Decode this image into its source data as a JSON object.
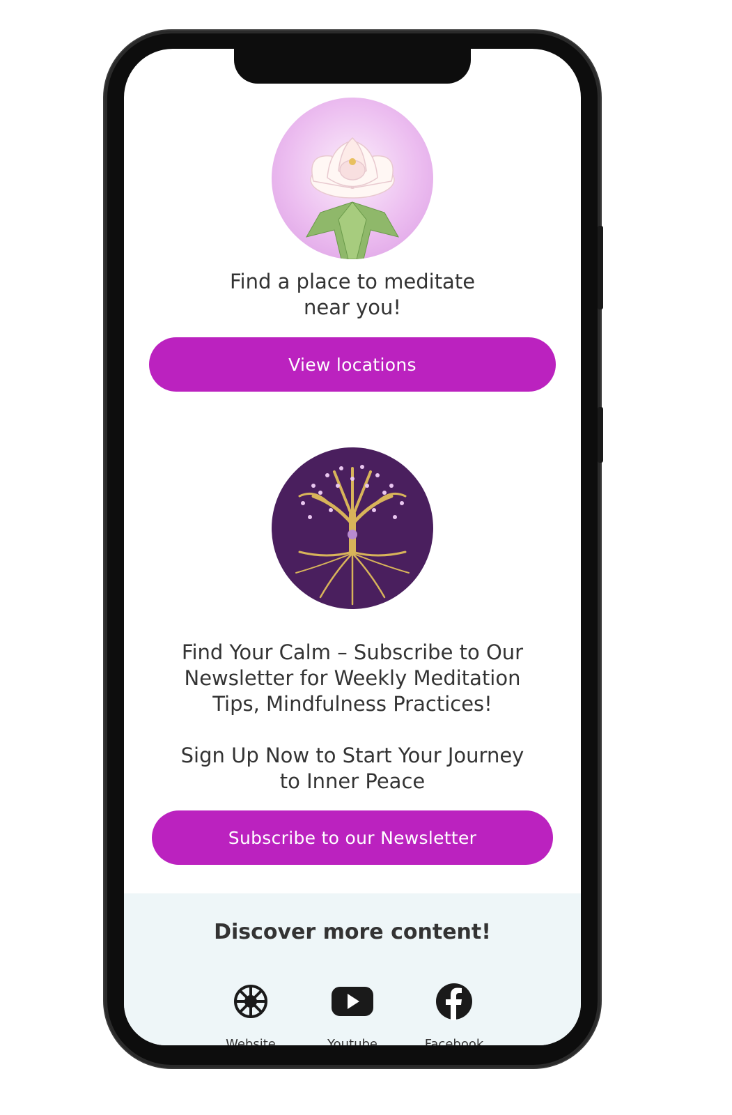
{
  "locations": {
    "heading": "Find a place to meditate\nnear you!",
    "button_label": "View locations",
    "image_icon": "lotus-flower-icon"
  },
  "newsletter": {
    "heading": "Find Your Calm – Subscribe to Our\nNewsletter for Weekly Meditation\nTips, Mindfulness Practices!",
    "subheading": "Sign Up Now to Start Your Journey\nto Inner Peace",
    "button_label": "Subscribe to our Newsletter",
    "image_icon": "tree-of-life-icon"
  },
  "footer": {
    "title": "Discover more content!",
    "links": [
      {
        "label": "Website",
        "icon": "dharma-wheel-icon"
      },
      {
        "label": "Youtube",
        "icon": "youtube-icon"
      },
      {
        "label": "Facebook",
        "icon": "facebook-icon"
      }
    ]
  },
  "colors": {
    "accent": "#bb22bf",
    "footer_bg": "#eef6f8",
    "text": "#333333"
  }
}
